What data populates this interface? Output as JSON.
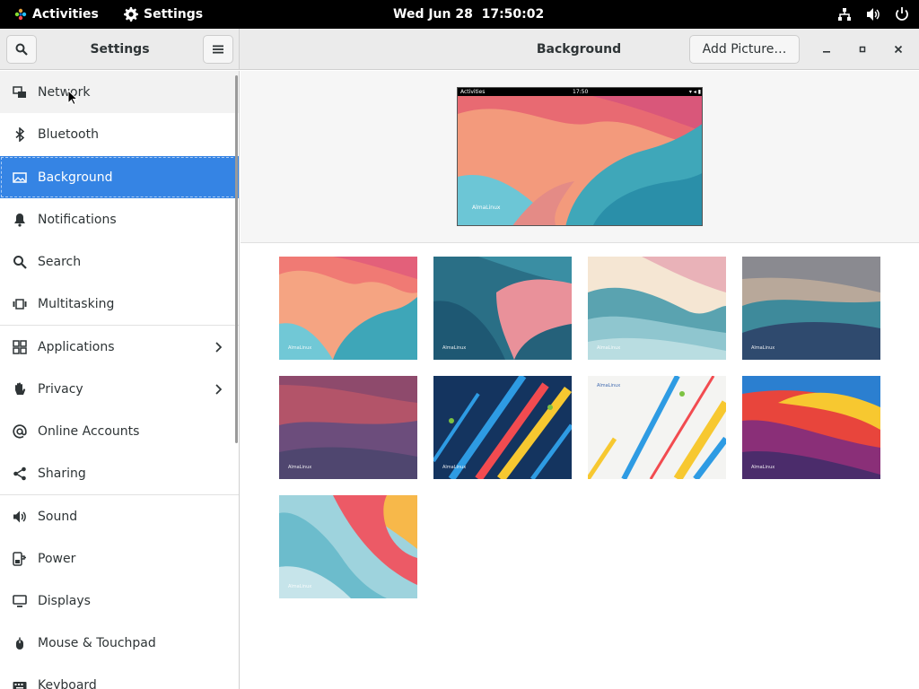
{
  "topbar": {
    "activities_label": "Activities",
    "app_name": "Settings",
    "clock": "Wed Jun 28  17:50:02"
  },
  "window": {
    "sidebar_title": "Settings",
    "page_title": "Background",
    "add_picture_label": "Add Picture…"
  },
  "sidebar": {
    "items": [
      {
        "label": "Network",
        "icon": "network-icon"
      },
      {
        "label": "Bluetooth",
        "icon": "bluetooth-icon"
      },
      {
        "label": "Background",
        "icon": "background-icon",
        "selected": true
      },
      {
        "label": "Notifications",
        "icon": "bell-icon"
      },
      {
        "label": "Search",
        "icon": "search-icon"
      },
      {
        "label": "Multitasking",
        "icon": "multitasking-icon"
      },
      {
        "label": "Applications",
        "icon": "apps-grid-icon",
        "chevron": true
      },
      {
        "label": "Privacy",
        "icon": "hand-icon",
        "chevron": true
      },
      {
        "label": "Online Accounts",
        "icon": "at-icon"
      },
      {
        "label": "Sharing",
        "icon": "share-icon"
      },
      {
        "label": "Sound",
        "icon": "speaker-icon"
      },
      {
        "label": "Power",
        "icon": "power-plug-icon"
      },
      {
        "label": "Displays",
        "icon": "display-icon"
      },
      {
        "label": "Mouse & Touchpad",
        "icon": "mouse-icon"
      },
      {
        "label": "Keyboard",
        "icon": "keyboard-icon"
      }
    ]
  },
  "preview": {
    "activities": "Activities",
    "time": "17:50",
    "logo_text": "AlmaLinux"
  },
  "wallpapers": {
    "logo_text": "AlmaLinux",
    "count": 9
  },
  "colors": {
    "accent": "#3584e4",
    "headerbar": "#ebebeb",
    "topbar": "#000000"
  }
}
